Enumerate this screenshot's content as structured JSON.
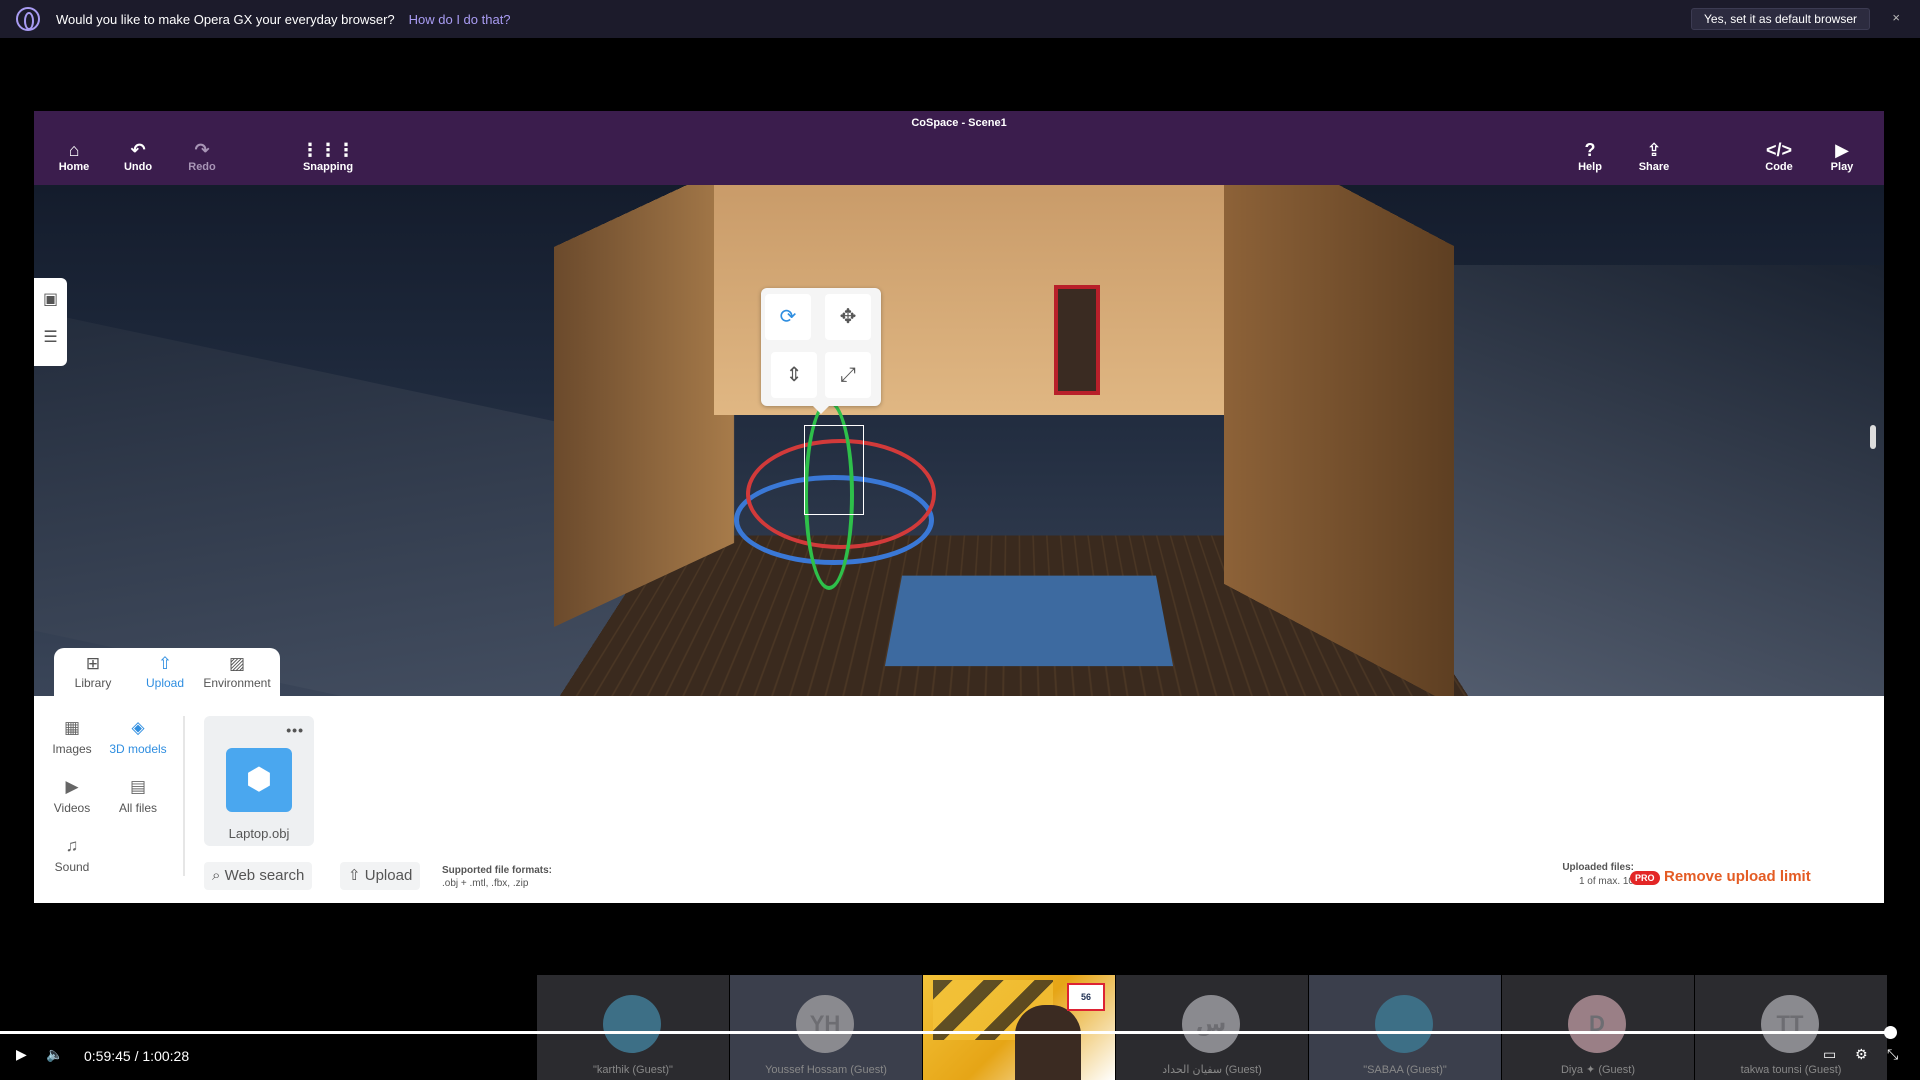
{
  "opera": {
    "message": "Would you like to make Opera GX your everyday browser?",
    "link": "How do I do that?",
    "default_button": "Yes, set it as default browser",
    "close": "×"
  },
  "app": {
    "title": "CoSpace - Scene1",
    "toolbar": {
      "home": "Home",
      "undo": "Undo",
      "redo": "Redo",
      "snapping": "Snapping",
      "help": "Help",
      "share": "Share",
      "code": "Code",
      "play": "Play"
    },
    "tabs": [
      "Library",
      "Upload",
      "Environment"
    ],
    "active_tab": "Upload",
    "categories": [
      "Images",
      "3D models",
      "Videos",
      "All files",
      "Sound"
    ],
    "active_category": "3D models",
    "file": {
      "name": "Laptop.obj",
      "menu": "•••"
    },
    "web_search": "Web search",
    "upload": "Upload",
    "formats_label": "Supported file formats:",
    "formats_value": ".obj + .mtl, .fbx, .zip",
    "uploaded_label": "Uploaded files:",
    "uploaded_value": "1 of max. 10",
    "pro_badge": "PRO",
    "remove_limit": "Remove upload limit"
  },
  "participants": [
    {
      "initials": "",
      "name": "\"karthik (Guest)\"",
      "bg": "#3d6f86"
    },
    {
      "initials": "YH",
      "name": "Youssef Hossam (Guest)",
      "bg": "#8a8a8f"
    },
    {
      "initials": "",
      "name": "",
      "bg": ""
    },
    {
      "initials": "س",
      "name": "سفيان الحداد (Guest)",
      "bg": "#8a8a8f"
    },
    {
      "initials": "",
      "name": "\"SABAA (Guest)\"",
      "bg": "#3d6f86"
    },
    {
      "initials": "D",
      "name": "Diya ✦ (Guest)",
      "bg": "#9a7f86"
    },
    {
      "initials": "TT",
      "name": "takwa tounsi (Guest)",
      "bg": "#8a8a8f"
    }
  ],
  "player": {
    "current": "0:59:45",
    "separator": "/",
    "duration": "1:00:28",
    "progress": 0.9988
  }
}
